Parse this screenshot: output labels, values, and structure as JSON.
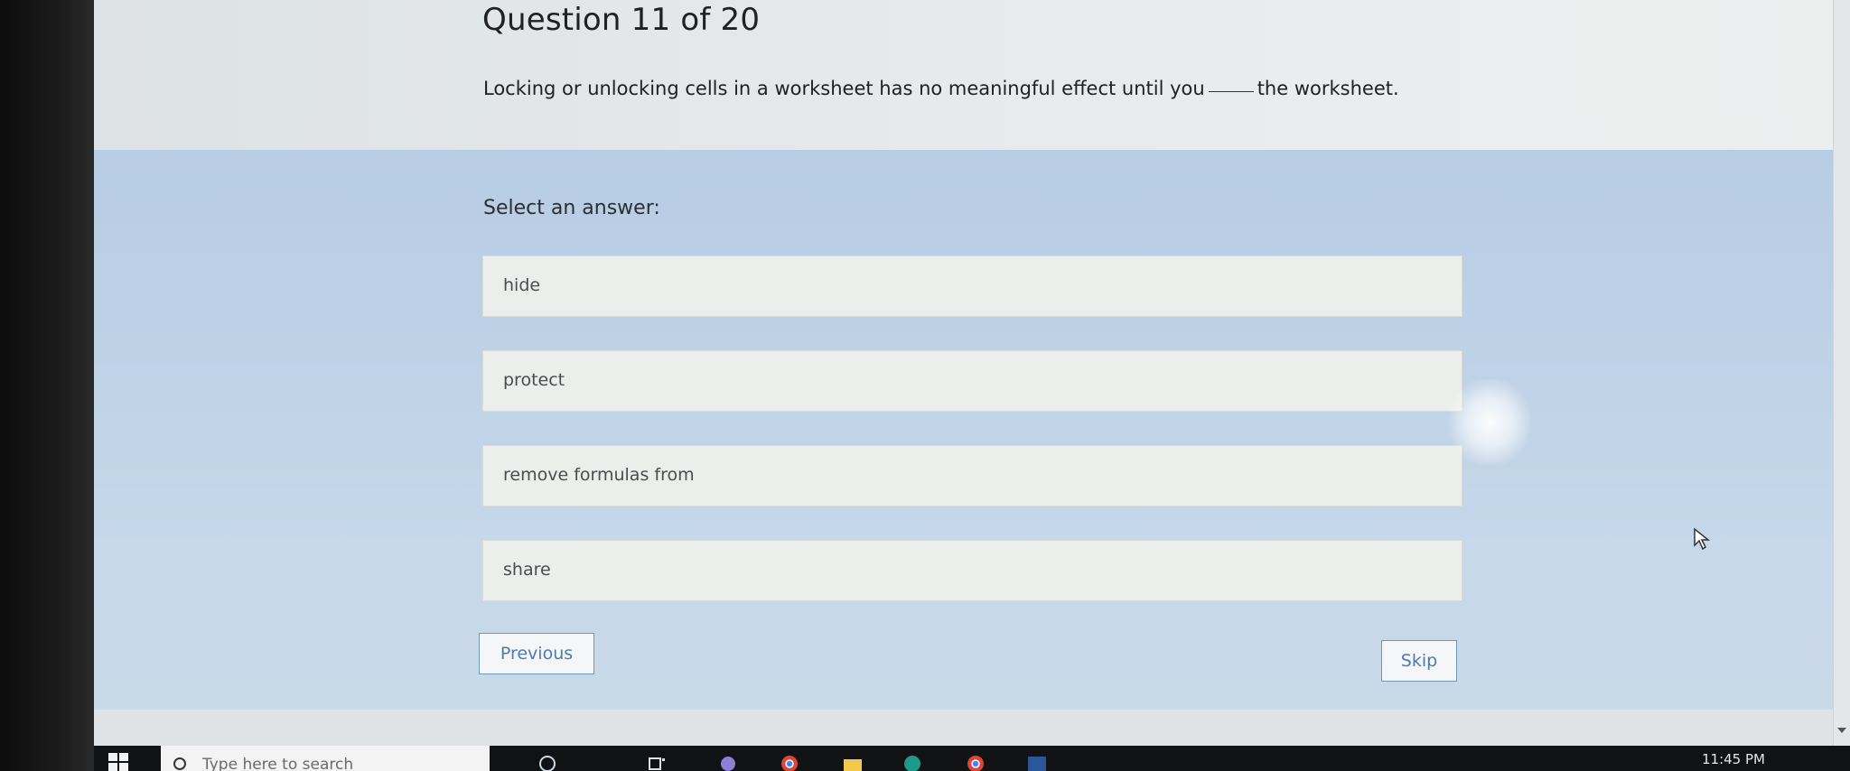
{
  "quiz": {
    "title": "Question 11 of 20",
    "question_before": "Locking or unlocking cells in a worksheet has no meaningful effect until you",
    "question_after": "the worksheet.",
    "select_label": "Select an answer:",
    "options": [
      {
        "label": "hide"
      },
      {
        "label": "protect"
      },
      {
        "label": "remove formulas from"
      },
      {
        "label": "share"
      }
    ],
    "previous_label": "Previous",
    "skip_label": "Skip"
  },
  "taskbar": {
    "search_placeholder": "Type here to search",
    "clock": "11:45 PM"
  },
  "colors": {
    "answer_background": "#bdd1e6",
    "option_background": "#eceeec",
    "button_text": "#4c7bb0"
  }
}
